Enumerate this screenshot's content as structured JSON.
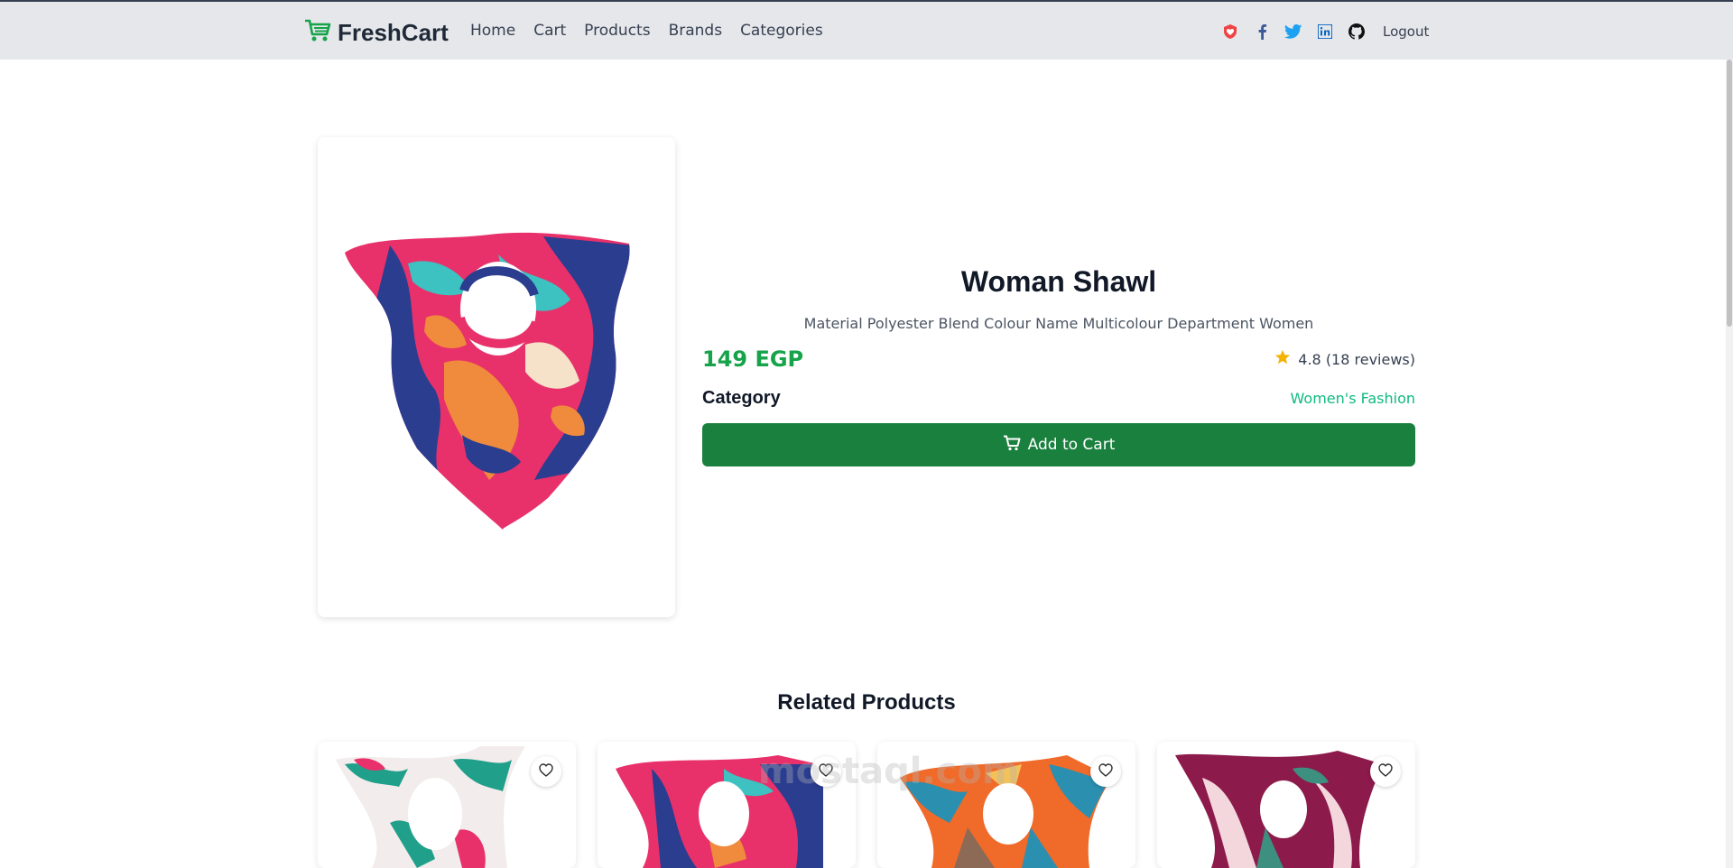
{
  "navbar": {
    "brand": "FreshCart",
    "links": [
      "Home",
      "Cart",
      "Products",
      "Brands",
      "Categories"
    ],
    "social_icons": [
      "heart-badge-icon",
      "facebook-icon",
      "twitter-icon",
      "linkedin-icon",
      "github-icon"
    ],
    "logout": "Logout"
  },
  "product": {
    "title": "Woman Shawl",
    "description": "Material Polyester Blend Colour Name Multicolour Department Women",
    "price": "149 EGP",
    "rating": "4.8 (18 reviews)",
    "category_label": "Category",
    "category": "Women's Fashion",
    "add_to_cart": "Add to Cart"
  },
  "related": {
    "title": "Related Products",
    "count_visible": 4
  },
  "watermark": "mostaql.com",
  "colors": {
    "brand_green": "#16a34a",
    "button_green": "#1a803e",
    "category_link": "#10b981",
    "navbar_bg": "#e5e7eb",
    "star": "#f5b301"
  }
}
